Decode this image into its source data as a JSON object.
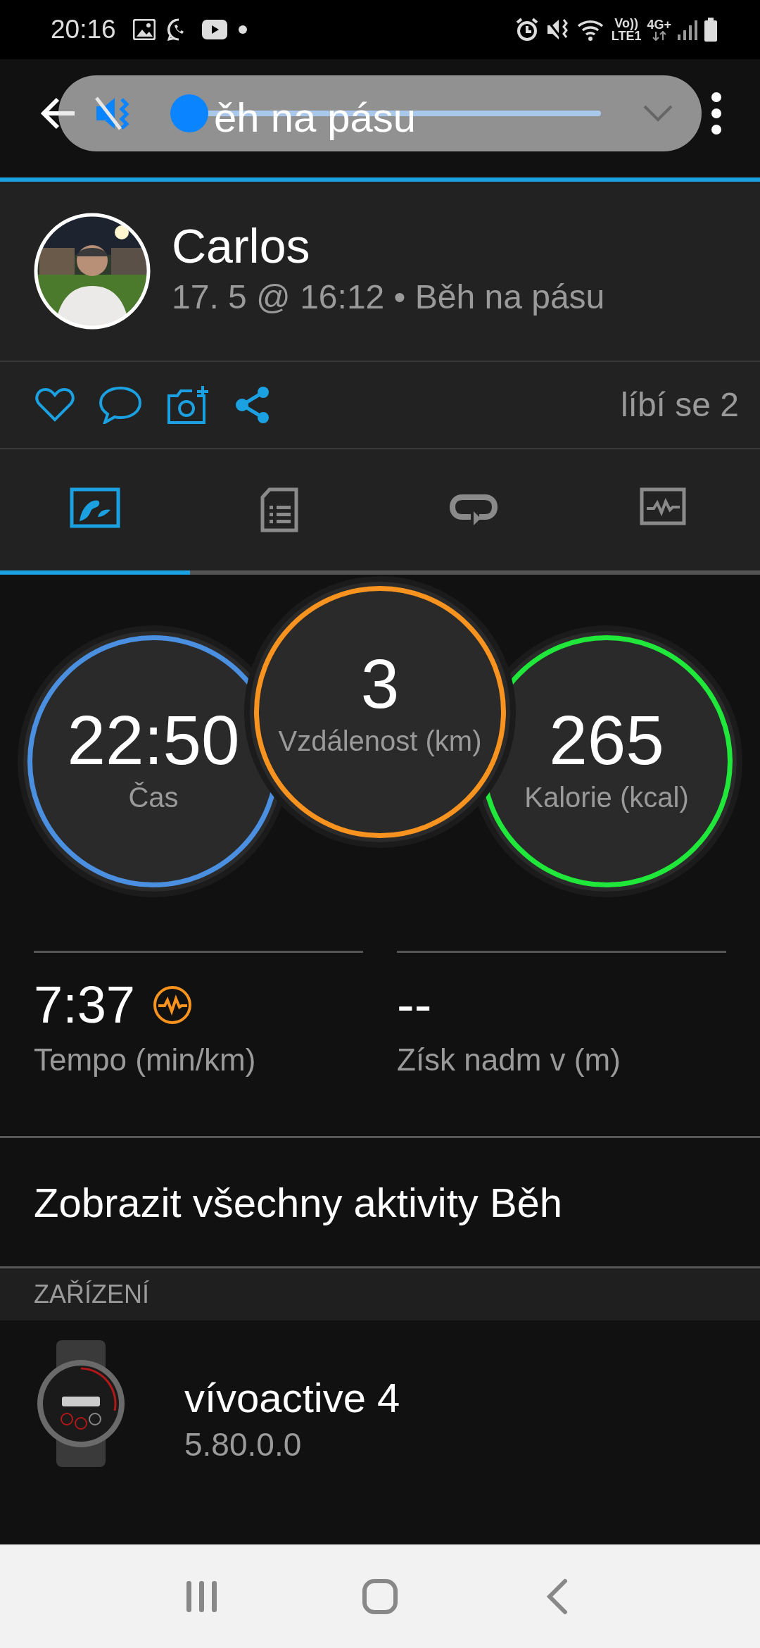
{
  "status_bar": {
    "time": "20:16",
    "volte": "Vo))",
    "lte": "LTE1",
    "network": "4G+"
  },
  "app_bar": {
    "title": "ěh na pásu"
  },
  "volume_popup": {
    "muted": true,
    "level": 0
  },
  "activity": {
    "name": "Carlos",
    "subtitle": "17. 5 @ 16:12 • Běh na pásu",
    "likes": "líbí se 2"
  },
  "tabs": [
    {
      "kind": "overview",
      "selected": true
    },
    {
      "kind": "details",
      "selected": false
    },
    {
      "kind": "laps",
      "selected": false
    },
    {
      "kind": "charts",
      "selected": false
    }
  ],
  "gauges": [
    {
      "value": "22:50",
      "label": "Čas",
      "color": "#4a8fe0"
    },
    {
      "value": "3",
      "label": "Vzdálenost (km)",
      "color": "#f7931e"
    },
    {
      "value": "265",
      "label": "Kalorie (kcal)",
      "color": "#1fe83a"
    }
  ],
  "stats": [
    {
      "value": "7:37",
      "label": "Tempo (min/km)",
      "heart_rate_icon": true
    },
    {
      "value": "--",
      "label": "Získ nadm v (m)",
      "heart_rate_icon": false
    }
  ],
  "all_activities_link": "Zobrazit všechny aktivity Běh",
  "devices": {
    "header": "ZAŘÍZENÍ",
    "items": [
      {
        "name": "vívoactive 4",
        "version": "5.80.0.0"
      }
    ]
  }
}
